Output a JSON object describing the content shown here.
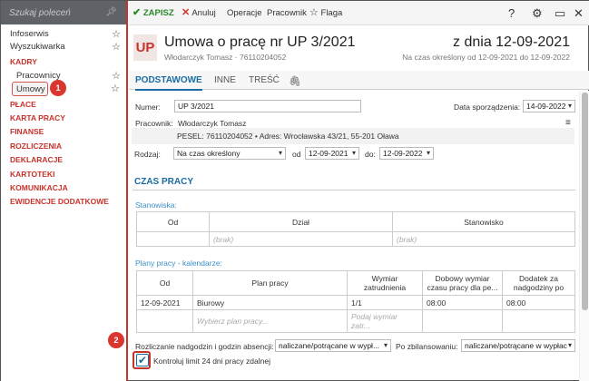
{
  "sidebar": {
    "search_placeholder": "Szukaj poleceń",
    "items": [
      {
        "label": "Infoserwis"
      },
      {
        "label": "Wyszukiwarka"
      }
    ],
    "categories": {
      "kadry": "KADRY",
      "place": "PŁACE",
      "karta_pracy": "KARTA PRACY",
      "finanse": "FINANSE",
      "rozliczenia": "ROZLICZENIA",
      "deklaracje": "DEKLARACJE",
      "kartoteki": "KARTOTEKI",
      "komunikacja": "KOMUNIKACJA",
      "ewidencje": "EWIDENCJE DODATKOWE"
    },
    "sub_items": [
      {
        "label": "Pracownicy"
      },
      {
        "label": "Umowy"
      }
    ]
  },
  "badges": {
    "one": "1",
    "two": "2"
  },
  "toolbar": {
    "save": "ZAPISZ",
    "cancel": "Anuluj",
    "operations": "Operacje",
    "employee": "Pracownik",
    "flag": "Flaga"
  },
  "header": {
    "abbr": "UP",
    "title": "Umowa o pracę nr UP 3/2021",
    "subtitle": "Włodarczyk Tomasz  ·  76110204052",
    "date": "z dnia 12-09-2021",
    "period": "Na czas określony od 12-09-2021 do 12-09-2022"
  },
  "tabs": [
    {
      "label": "PODSTAWOWE"
    },
    {
      "label": "INNE"
    },
    {
      "label": "TREŚĆ"
    }
  ],
  "form": {
    "numer_label": "Numer:",
    "numer_value": "UP 3/2021",
    "data_label": "Data sporządzenia:",
    "data_value": "14-09-2022",
    "pracownik_label": "Pracownik:",
    "pracownik_value": "Włodarczyk Tomasz",
    "pesel_line": "PESEL: 76110204052  •  Adres: Wrocławska 43/21, 55-201 Oława",
    "rodzaj_label": "Rodzaj:",
    "rodzaj_value": "Na czas określony",
    "od_label": "od",
    "od_value": "12-09-2021",
    "do_label": "do:",
    "do_value": "12-09-2022"
  },
  "czas_pracy": {
    "title": "CZAS PRACY",
    "stanowiska_title": "Stanowiska:",
    "stanowiska_headers": [
      "Od",
      "Dział",
      "Stanowisko"
    ],
    "stanowiska_placeholders": [
      "(brak)",
      "(brak)"
    ],
    "plany_title": "Plany pracy - kalendarze:",
    "plany_headers": [
      "Od",
      "Plan pracy",
      "Wymiar zatrudnienia",
      "Dobowy wymiar czasu pracy dla pe...",
      "Dodatek za nadgodziny po"
    ],
    "plany_row": [
      "12-09-2021",
      "Biurowy",
      "1/1",
      "08:00",
      "08:00"
    ],
    "plany_placeholders": [
      "Wybierz plan pracy...",
      "Podaj wymiar zatr..."
    ]
  },
  "footer": {
    "rozliczanie_label": "Rozliczanie nadgodzin i godzin absencji:",
    "rozliczanie_value": "naliczane/potrącane w wypł...",
    "zbilansowaniu_label": "Po zbilansowaniu:",
    "zbilansowaniu_value": "naliczane/potrącane w wypłac",
    "checkbox_label": "Kontroluj limit 24 dni pracy zdalnej",
    "checkbox_checked": true
  }
}
